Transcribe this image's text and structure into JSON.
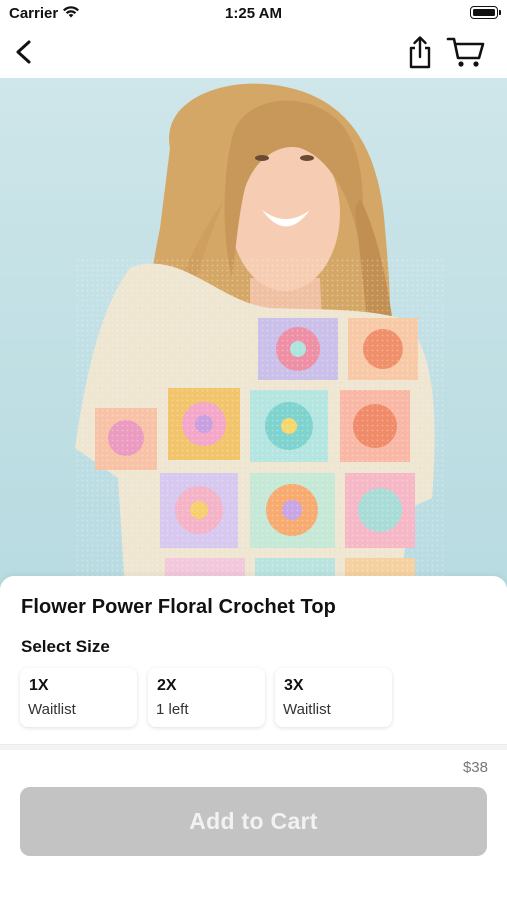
{
  "status_bar": {
    "carrier": "Carrier",
    "time": "1:25 AM"
  },
  "nav": {
    "back_icon": "chevron-left-icon",
    "share_icon": "share-icon",
    "cart_icon": "cart-icon"
  },
  "product": {
    "title": "Flower Power Floral Crochet Top",
    "image_description": "product-photo",
    "select_size_label": "Select Size",
    "sizes": [
      {
        "size": "1X",
        "status": "Waitlist"
      },
      {
        "size": "2X",
        "status": "1 left"
      },
      {
        "size": "3X",
        "status": "Waitlist"
      }
    ],
    "price": "$38",
    "add_to_cart_label": "Add to Cart"
  },
  "colors": {
    "accent_disabled": "#c3c3c3",
    "background": "#ffffff",
    "hero_background": "#c3e1e6"
  }
}
